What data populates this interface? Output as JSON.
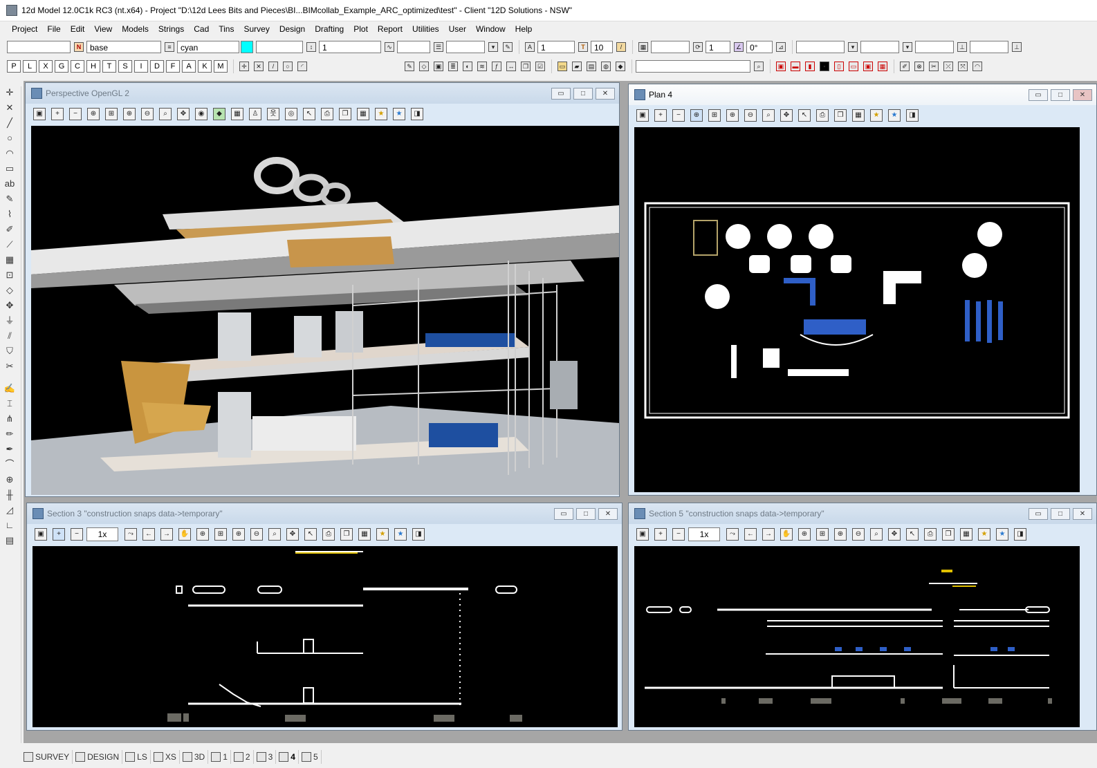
{
  "app": {
    "title": "12d Model  12.0C1k RC3 (nt.x64) - Project \"D:\\12d Lees Bits and Pieces\\BI...BIMcollab_Example_ARC_optimized\\test\" - Client \"12D Solutions - NSW\""
  },
  "menu": [
    "Project",
    "File",
    "Edit",
    "View",
    "Models",
    "Strings",
    "Cad",
    "Tins",
    "Survey",
    "Design",
    "Drafting",
    "Plot",
    "Report",
    "Utilities",
    "User",
    "Window",
    "Help"
  ],
  "toolbar1": {
    "model_field": "",
    "name_field": "base",
    "colour_field": "cyan",
    "colour_hex": "#00ffff",
    "style_field": "",
    "weight_field": "1",
    "linestyle_field": "",
    "text_field": "",
    "text_height_field": "1",
    "text_size_field": "10",
    "angle_count_field": "1",
    "angle_field": "0°"
  },
  "toolbar2": {
    "letter_buttons": [
      "P",
      "L",
      "X",
      "G",
      "C",
      "H",
      "T",
      "S",
      "I",
      "D",
      "F",
      "A",
      "K",
      "M"
    ],
    "search_field": ""
  },
  "windows": {
    "perspective": {
      "title": "Perspective OpenGL 2"
    },
    "plan": {
      "title": "Plan 4"
    },
    "section3": {
      "title": "Section 3 \"construction snaps data->temporary\"",
      "zoom": "1x"
    },
    "section5": {
      "title": "Section 5 \"construction snaps data->temporary\"",
      "zoom": "1x"
    }
  },
  "bottom_tabs": [
    {
      "label": "SURVEY",
      "selected": false
    },
    {
      "label": "DESIGN",
      "selected": false
    },
    {
      "label": "LS",
      "selected": false
    },
    {
      "label": "XS",
      "selected": false
    },
    {
      "label": "3D",
      "selected": false
    },
    {
      "label": "1",
      "selected": false
    },
    {
      "label": "2",
      "selected": false
    },
    {
      "label": "3",
      "selected": false
    },
    {
      "label": "4",
      "selected": true
    },
    {
      "label": "5",
      "selected": false
    }
  ]
}
